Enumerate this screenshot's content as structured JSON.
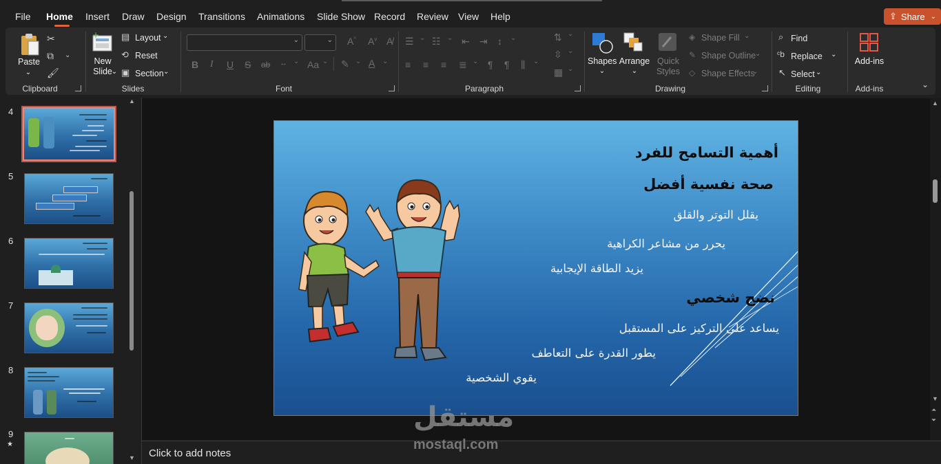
{
  "menu": {
    "tabs": [
      "File",
      "Home",
      "Insert",
      "Draw",
      "Design",
      "Transitions",
      "Animations",
      "Slide Show",
      "Record",
      "Review",
      "View",
      "Help"
    ],
    "active_tab": "Home",
    "share_label": "Share"
  },
  "ribbon": {
    "clipboard": {
      "paste": "Paste",
      "group": "Clipboard"
    },
    "slides": {
      "new_slide": "New Slide",
      "layout": "Layout",
      "reset": "Reset",
      "section": "Section",
      "group": "Slides"
    },
    "font": {
      "group": "Font",
      "font_name": "",
      "font_size": "",
      "bold": "B",
      "italic": "I",
      "underline": "U",
      "strike": "S",
      "abc": "ab",
      "case": "Aa",
      "color": "A"
    },
    "paragraph": {
      "group": "Paragraph"
    },
    "drawing": {
      "shapes": "Shapes",
      "arrange": "Arrange",
      "quick_styles": "Quick Styles",
      "shape_fill": "Shape Fill",
      "shape_outline": "Shape Outline",
      "shape_effects": "Shape Effects",
      "group": "Drawing"
    },
    "editing": {
      "find": "Find",
      "replace": "Replace",
      "select": "Select",
      "group": "Editing"
    },
    "addins": {
      "label": "Add-ins",
      "group": "Add-ins"
    }
  },
  "thumbnails": {
    "numbers": [
      "4",
      "5",
      "6",
      "7",
      "8",
      "9"
    ],
    "selected": "4",
    "star": "★"
  },
  "slide": {
    "heading1": "أهمية التسامح للفرد",
    "heading2": "صحة نفسية أفضل",
    "bullet1": "يقلل التوتر والقلق",
    "bullet2": "يحرر من مشاعر الكراهية",
    "bullet3": "يزيد الطاقة الإيجابية",
    "heading3": "نضج شخصي",
    "bullet4": "يساعد على التركيز على المستقبل",
    "bullet5": "يطور القدرة على التعاطف",
    "bullet6": "يقوي الشخصية"
  },
  "notes": {
    "placeholder": "Click to add notes"
  },
  "watermark": {
    "arabic": "مستقل",
    "latin": "mostaql.com"
  },
  "colors": {
    "accent": "#e0653b",
    "share": "#c9522d",
    "slide_top": "#5fb3e3",
    "slide_bottom": "#1a4f8f"
  }
}
